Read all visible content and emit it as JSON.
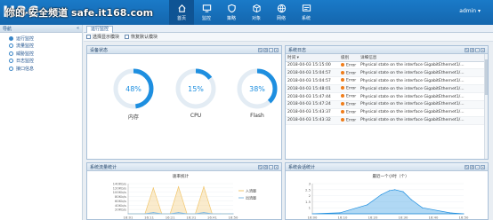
{
  "header": {
    "logo_text": "H3C",
    "watermark": "你的·安全频道 safe.it168.com",
    "user": "admin ▾",
    "nav": [
      {
        "label": "首页",
        "icon": "home-icon",
        "active": true
      },
      {
        "label": "监控",
        "icon": "monitor-icon",
        "active": false
      },
      {
        "label": "策略",
        "icon": "shield-icon",
        "active": false
      },
      {
        "label": "对象",
        "icon": "object-icon",
        "active": false
      },
      {
        "label": "网络",
        "icon": "network-icon",
        "active": false
      },
      {
        "label": "系统",
        "icon": "system-icon",
        "active": false
      }
    ]
  },
  "sidebar": {
    "title": "导航",
    "items": [
      {
        "label": "运行监控"
      },
      {
        "label": "流量监控"
      },
      {
        "label": "威胁监控"
      },
      {
        "label": "日志监控"
      },
      {
        "label": "接口信息"
      }
    ]
  },
  "tabs": {
    "active": "运行监控"
  },
  "toolbar": {
    "select_label": "选择显示模块",
    "restore_label": "恢复默认模块"
  },
  "device_status": {
    "title": "设备状态",
    "gauges": [
      {
        "label": "内存",
        "value": 48,
        "text": "48%"
      },
      {
        "label": "CPU",
        "value": 15,
        "text": "15%"
      },
      {
        "label": "Flash",
        "value": 38,
        "text": "38%"
      }
    ]
  },
  "system_log": {
    "title": "系统日志",
    "columns": [
      "时间 ▾",
      "级别",
      "详细信息"
    ],
    "rows": [
      {
        "time": "2018-04-03 15:15:00",
        "level": "Error",
        "detail": "Physical state on the interface GigabitEthernet1/..."
      },
      {
        "time": "2018-04-03 15:04:57",
        "level": "Error",
        "detail": "Physical state on the interface GigabitEthernet1/..."
      },
      {
        "time": "2018-04-03 15:04:57",
        "level": "Error",
        "detail": "Physical state on the interface GigabitEthernet1/..."
      },
      {
        "time": "2018-04-03 15:48:01",
        "level": "Error",
        "detail": "Physical state on the interface GigabitEthernet1/..."
      },
      {
        "time": "2018-04-03 15:47:44",
        "level": "Error",
        "detail": "Physical state on the interface GigabitEthernet1/..."
      },
      {
        "time": "2018-04-03 15:47:24",
        "level": "Error",
        "detail": "Physical state on the interface GigabitEthernet1/..."
      },
      {
        "time": "2018-04-03 15:43:37",
        "level": "Error",
        "detail": "Physical state on the interface GigabitEthernet1/..."
      },
      {
        "time": "2018-04-03 15:43:32",
        "level": "Error",
        "detail": "Physical state on the interface GigabitEthernet1/..."
      }
    ]
  },
  "traffic_panel": {
    "title": "系统流量统计"
  },
  "session_panel": {
    "title": "系统会话统计"
  },
  "colors": {
    "accent": "#1e8fe0",
    "header": "#1570b9",
    "error": "#f07d1a"
  },
  "chart_data": [
    {
      "type": "area",
      "title": "速率统计",
      "y_ticks": [
        "140Kb/s",
        "120Kb/s",
        "100Kb/s",
        "80Kb/s",
        "60Kb/s",
        "40Kb/s",
        "20Kb/s"
      ],
      "ylim": [
        0,
        140
      ],
      "x_ticks": [
        "16:01",
        "16:11",
        "16:21",
        "16:31",
        "16:41",
        "16:50"
      ],
      "legend_position": "right",
      "series": [
        {
          "name": "入流量",
          "color": "#f2c76e",
          "x": [
            0,
            8,
            12,
            16,
            20,
            24,
            28,
            32,
            36,
            40,
            44,
            48,
            50
          ],
          "values": [
            0,
            0,
            120,
            0,
            0,
            125,
            0,
            0,
            125,
            0,
            0,
            0,
            0
          ]
        },
        {
          "name": "出流量",
          "color": "#7fb9e6",
          "x": [
            0,
            8,
            12,
            16,
            20,
            24,
            28,
            32,
            36,
            40,
            44,
            48,
            50
          ],
          "values": [
            0,
            0,
            6,
            0,
            0,
            6,
            0,
            0,
            6,
            0,
            0,
            0,
            0
          ]
        }
      ]
    },
    {
      "type": "area",
      "title": "最近一个小时（个）",
      "y_ticks": [
        "3",
        "2.5",
        "2",
        "1.5",
        "1"
      ],
      "ylim": [
        0,
        3
      ],
      "x_ticks": [
        "16:00",
        "16:10",
        "16:20",
        "16:30",
        "16:40",
        "16:50"
      ],
      "series": [
        {
          "name": "",
          "color": "#1e8fe0",
          "x": [
            0,
            10,
            20,
            25,
            28,
            30,
            33,
            36,
            40,
            50,
            55
          ],
          "values": [
            0.0,
            0.1,
            0.9,
            1.9,
            2.3,
            2.4,
            2.2,
            1.4,
            0.6,
            0.1,
            0.0
          ]
        }
      ]
    }
  ]
}
